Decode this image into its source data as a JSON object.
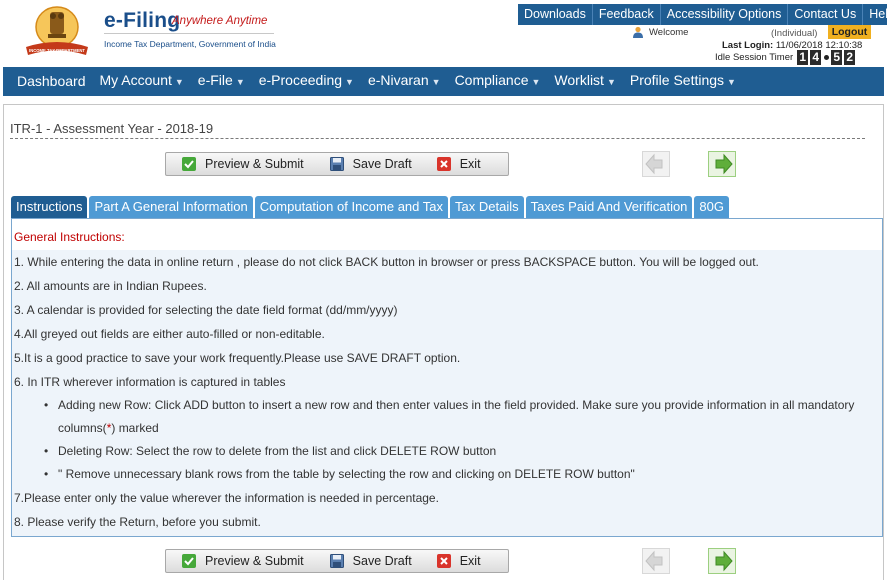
{
  "brand": {
    "title": "e-Filing",
    "tagline": "Anywhere Anytime",
    "subtitle": "Income Tax Department, Government of India",
    "emblem_text": "INCOME TAX DEPARTMENT"
  },
  "top_links": [
    "Downloads",
    "Feedback",
    "Accessibility Options",
    "Contact Us",
    "Help"
  ],
  "user": {
    "welcome_label": "Welcome",
    "role": "(Individual)",
    "logout_label": "Logout",
    "last_login_label": "Last Login:",
    "last_login_value": "11/06/2018 12:10:38",
    "idle_label": "Idle Session Timer",
    "timer_digits": [
      "1",
      "4",
      "5",
      "2"
    ]
  },
  "main_nav": [
    {
      "label": "Dashboard",
      "has_menu": false
    },
    {
      "label": "My Account",
      "has_menu": true
    },
    {
      "label": "e-File",
      "has_menu": true
    },
    {
      "label": "e-Proceeding",
      "has_menu": true
    },
    {
      "label": "e-Nivaran",
      "has_menu": true
    },
    {
      "label": "Compliance",
      "has_menu": true
    },
    {
      "label": "Worklist",
      "has_menu": true
    },
    {
      "label": "Profile Settings",
      "has_menu": true
    }
  ],
  "form": {
    "title": "ITR-1 - Assessment Year - 2018-19"
  },
  "toolbar": {
    "preview_label": "Preview & Submit",
    "save_label": "Save Draft",
    "exit_label": "Exit"
  },
  "tabs": [
    {
      "label": "Instructions",
      "active": true
    },
    {
      "label": "Part A General Information",
      "active": false
    },
    {
      "label": "Computation of Income and Tax",
      "active": false
    },
    {
      "label": "Tax Details",
      "active": false
    },
    {
      "label": "Taxes Paid And Verification",
      "active": false
    },
    {
      "label": "80G",
      "active": false
    }
  ],
  "instructions": {
    "heading": "General Instructions:",
    "items": [
      "1. While entering the data in online return , please do not click BACK button in browser or press BACKSPACE button. You will be logged out.",
      "2. All amounts are in Indian Rupees.",
      "3. A calendar is provided for selecting the date field format (dd/mm/yyyy)",
      "4.All greyed out fields are either auto-filled or non-editable.",
      "5.It is a good practice to save your work frequently.Please use SAVE DRAFT option.",
      "6. In ITR wherever information is captured in tables"
    ],
    "bullet_add_line1": "Adding new Row: Click ADD button to insert a new row and then enter values in the field provided. Make sure you provide information in all mandatory",
    "bullet_add_line2_pre": "columns(",
    "bullet_add_star": "*",
    "bullet_add_line2_post": ") marked",
    "bullet_delete": "Deleting Row: Select the row to delete from the list and click DELETE ROW button",
    "bullet_remove": "\" Remove unnecessary blank rows from the table by selecting the row and clicking on DELETE ROW button\"",
    "item7": "7.Please enter only the value wherever the information is needed in percentage.",
    "item8": "8. Please verify the Return, before you submit."
  },
  "colors": {
    "nav_blue": "#1f5d92",
    "tab_blue": "#4f9ad4",
    "logout_bg": "#f0b020",
    "heading_red": "#c00000",
    "next_green": "#5fae3a"
  }
}
